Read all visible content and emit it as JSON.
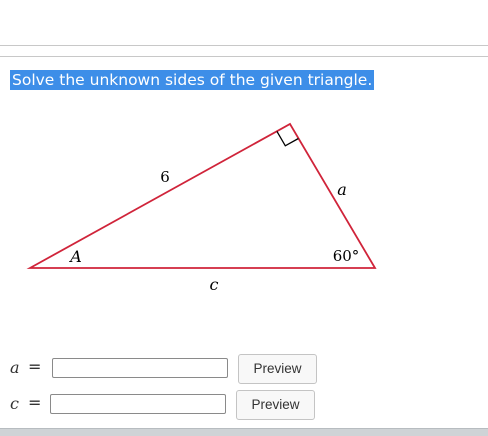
{
  "question": {
    "text": "Solve the unknown sides of the given triangle."
  },
  "figure": {
    "hypotenuse_label": "6",
    "side_a_label": "a",
    "side_c_label": "c",
    "angle_A_label": "A",
    "angle_B_label": "60°",
    "line_color": "#d0243a"
  },
  "answers": [
    {
      "variable": "a",
      "equals": "=",
      "value": "",
      "button_label": "Preview"
    },
    {
      "variable": "c",
      "equals": "=",
      "value": "",
      "button_label": "Preview"
    }
  ],
  "colors": {
    "highlight": "#3d8ee8",
    "rule": "#c8c8c8"
  }
}
